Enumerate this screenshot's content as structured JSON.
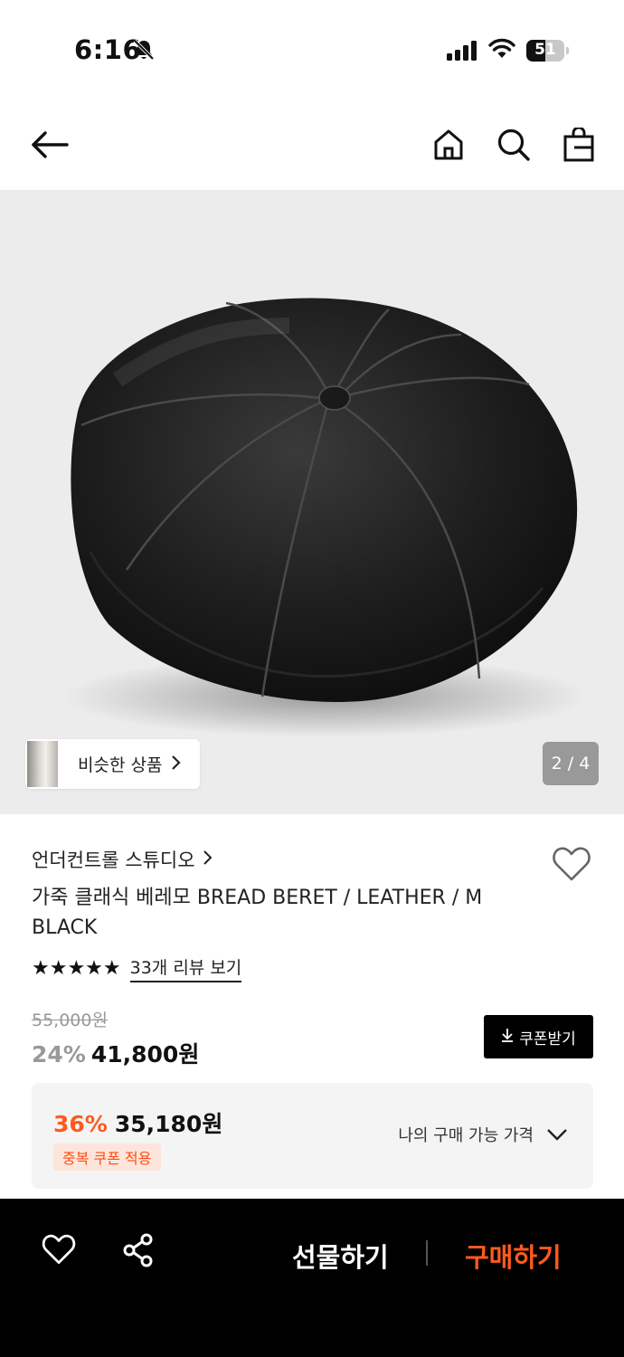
{
  "status_bar": {
    "time": "6:16",
    "battery": "51",
    "battery_level": 0.51
  },
  "header": {
    "icons": [
      "back-arrow-icon",
      "home-icon",
      "search-icon",
      "shopping-bag-icon"
    ]
  },
  "hero": {
    "similar_label": "비슷한 상품",
    "pager": "2 / 4",
    "image_description": "black leather beret"
  },
  "product": {
    "brand": "언더컨트롤 스튜디오",
    "title": "가죽 클래식 베레모 BREAD BERET / LEATHER / M BLACK",
    "rating_stars": 5,
    "stars_text": "★★★★★",
    "review_link": "33개 리뷰 보기",
    "original_price": "55,000원",
    "discount_pct": "24%",
    "price": "41,800원",
    "coupon_button": "쿠폰받기"
  },
  "my_price": {
    "discount_pct": "36%",
    "price": "35,180원",
    "tag": "중복 쿠폰 적용",
    "label": "나의 구매 가능 가격"
  },
  "bottom_bar": {
    "gift_label": "선물하기",
    "buy_label": "구매하기"
  },
  "colors": {
    "accent": "#ff5a1f",
    "bottom_bar": "#000000",
    "hero_bg": "#ececec"
  }
}
